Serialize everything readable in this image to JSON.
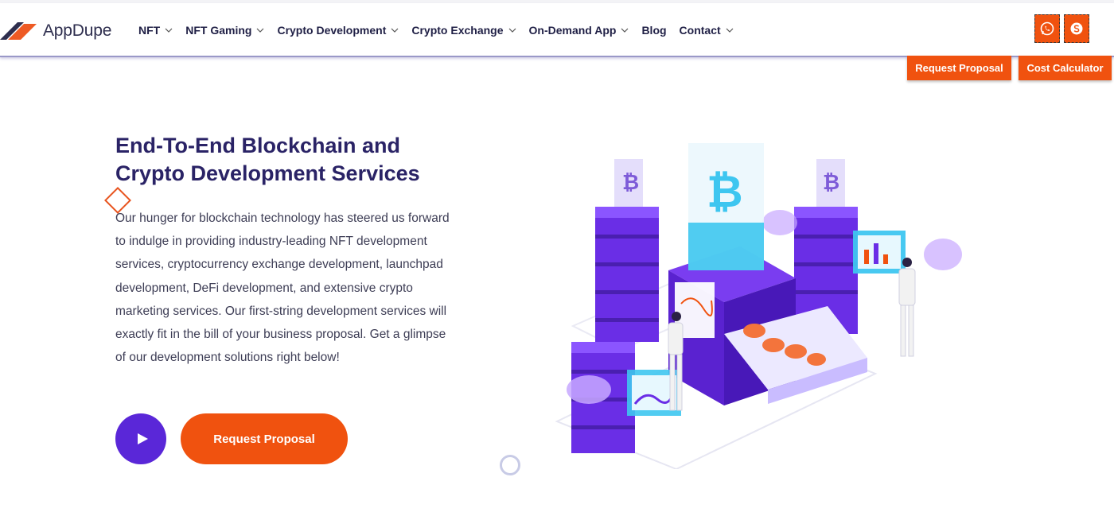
{
  "brand": {
    "name": "AppDupe"
  },
  "nav": [
    {
      "label": "NFT",
      "has_dropdown": true
    },
    {
      "label": "NFT Gaming",
      "has_dropdown": true
    },
    {
      "label": "Crypto Development",
      "has_dropdown": true
    },
    {
      "label": "Crypto Exchange",
      "has_dropdown": true
    },
    {
      "label": "On-Demand App",
      "has_dropdown": true
    },
    {
      "label": "Blog",
      "has_dropdown": false
    },
    {
      "label": "Contact",
      "has_dropdown": true
    }
  ],
  "social": [
    {
      "icon": "whatsapp-icon"
    },
    {
      "icon": "skype-icon"
    }
  ],
  "header_buttons": {
    "request_proposal": "Request Proposal",
    "cost_calculator": "Cost Calculator"
  },
  "hero": {
    "title_line1": "End-To-End Blockchain and",
    "title_line2": "Crypto Development Services",
    "description": "Our hunger for blockchain technology has steered us forward to indulge in providing industry-leading NFT development services, cryptocurrency exchange development, launchpad development, DeFi development, and extensive crypto marketing services. Our first-string development services will exactly fit in the bill of your business proposal. Get a glimpse of our development solutions right below!",
    "cta_label": "Request Proposal"
  },
  "colors": {
    "accent": "#f0520f",
    "primary": "#5a27d8",
    "heading": "#2a2366",
    "illustration_cyan": "#3ec6f0"
  }
}
